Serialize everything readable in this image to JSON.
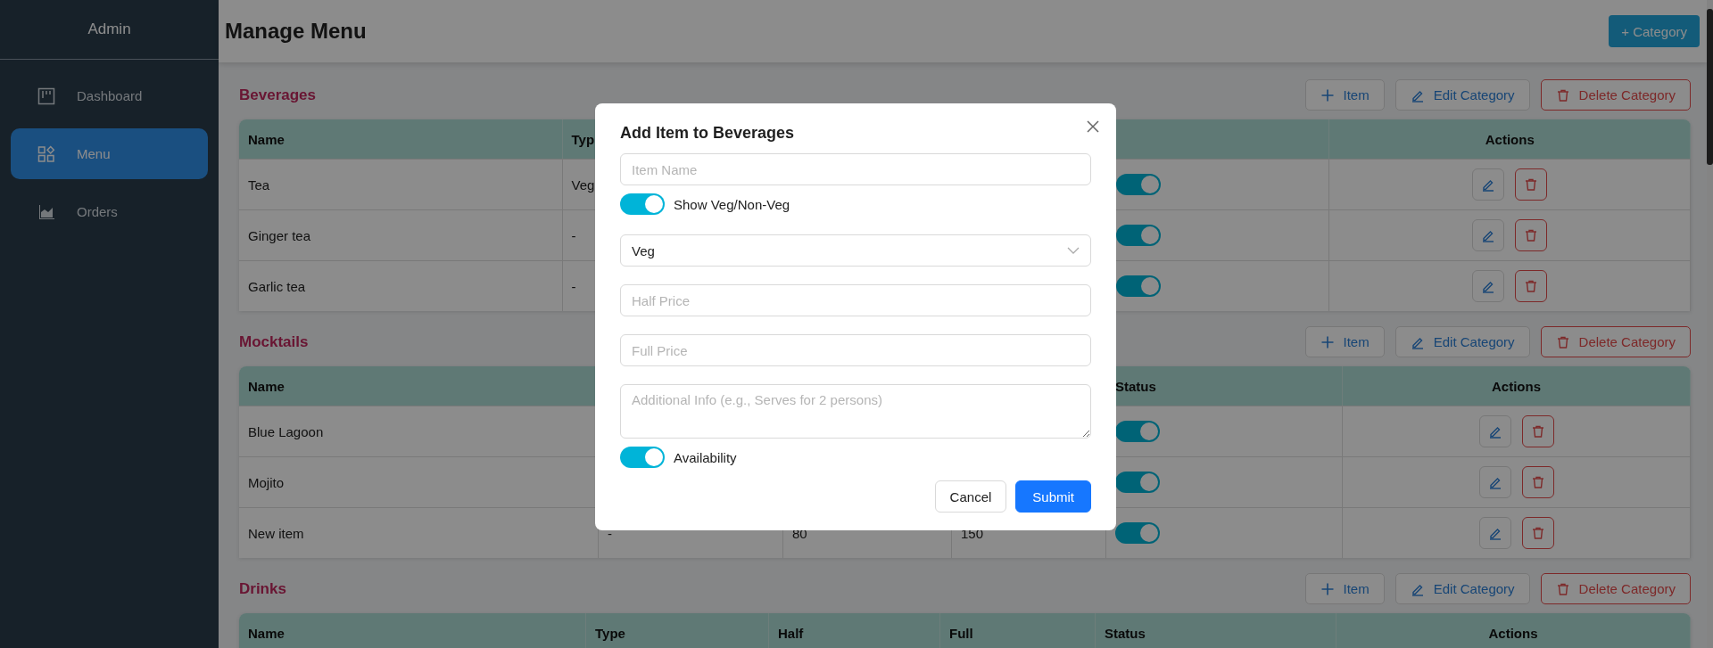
{
  "sidebar": {
    "title": "Admin",
    "items": [
      {
        "label": "Dashboard",
        "selected": false
      },
      {
        "label": "Menu",
        "selected": true
      },
      {
        "label": "Orders",
        "selected": false
      }
    ]
  },
  "header": {
    "title": "Manage Menu",
    "add_category": "+ Category"
  },
  "categories": [
    {
      "name": "Beverages",
      "buttons": {
        "add": "Item",
        "edit": "Edit Category",
        "delete": "Delete Category"
      },
      "columns": {
        "name": "Name",
        "type": "Typ",
        "actions": "Actions"
      },
      "rows": [
        {
          "name": "Tea",
          "type": "Veg",
          "on": true
        },
        {
          "name": "Ginger tea",
          "type": "-",
          "on": true
        },
        {
          "name": "Garlic tea",
          "type": "-",
          "on": true
        }
      ]
    },
    {
      "name": "Mocktails",
      "buttons": {
        "add": "Item",
        "edit": "Edit Category",
        "delete": "Delete Category"
      },
      "columns": {
        "name": "Name",
        "status": "Status",
        "actions": "Actions"
      },
      "rows": [
        {
          "name": "Blue Lagoon",
          "on": true
        },
        {
          "name": "Mojito",
          "on": true
        },
        {
          "name": "New item",
          "type": "-",
          "half": "80",
          "full": "150",
          "on": true
        }
      ]
    },
    {
      "name": "Drinks",
      "buttons": {
        "add": "Item",
        "edit": "Edit Category",
        "delete": "Delete Category"
      },
      "columns": {
        "name": "Name",
        "type": "Type",
        "half": "Half",
        "full": "Full",
        "status": "Status",
        "actions": "Actions"
      }
    }
  ],
  "modal": {
    "title": "Add Item to Beverages",
    "item_name": {
      "placeholder": "Item Name"
    },
    "veg_toggle": {
      "label": "Show Veg/Non-Veg",
      "on": true
    },
    "type_select": {
      "value": "Veg"
    },
    "half_price": {
      "placeholder": "Half Price"
    },
    "full_price": {
      "placeholder": "Full Price"
    },
    "additional_info": {
      "placeholder": "Additional Info (e.g., Serves for 2 persons)"
    },
    "availability": {
      "label": "Availability",
      "on": true
    },
    "buttons": {
      "cancel": "Cancel",
      "submit": "Submit"
    }
  }
}
